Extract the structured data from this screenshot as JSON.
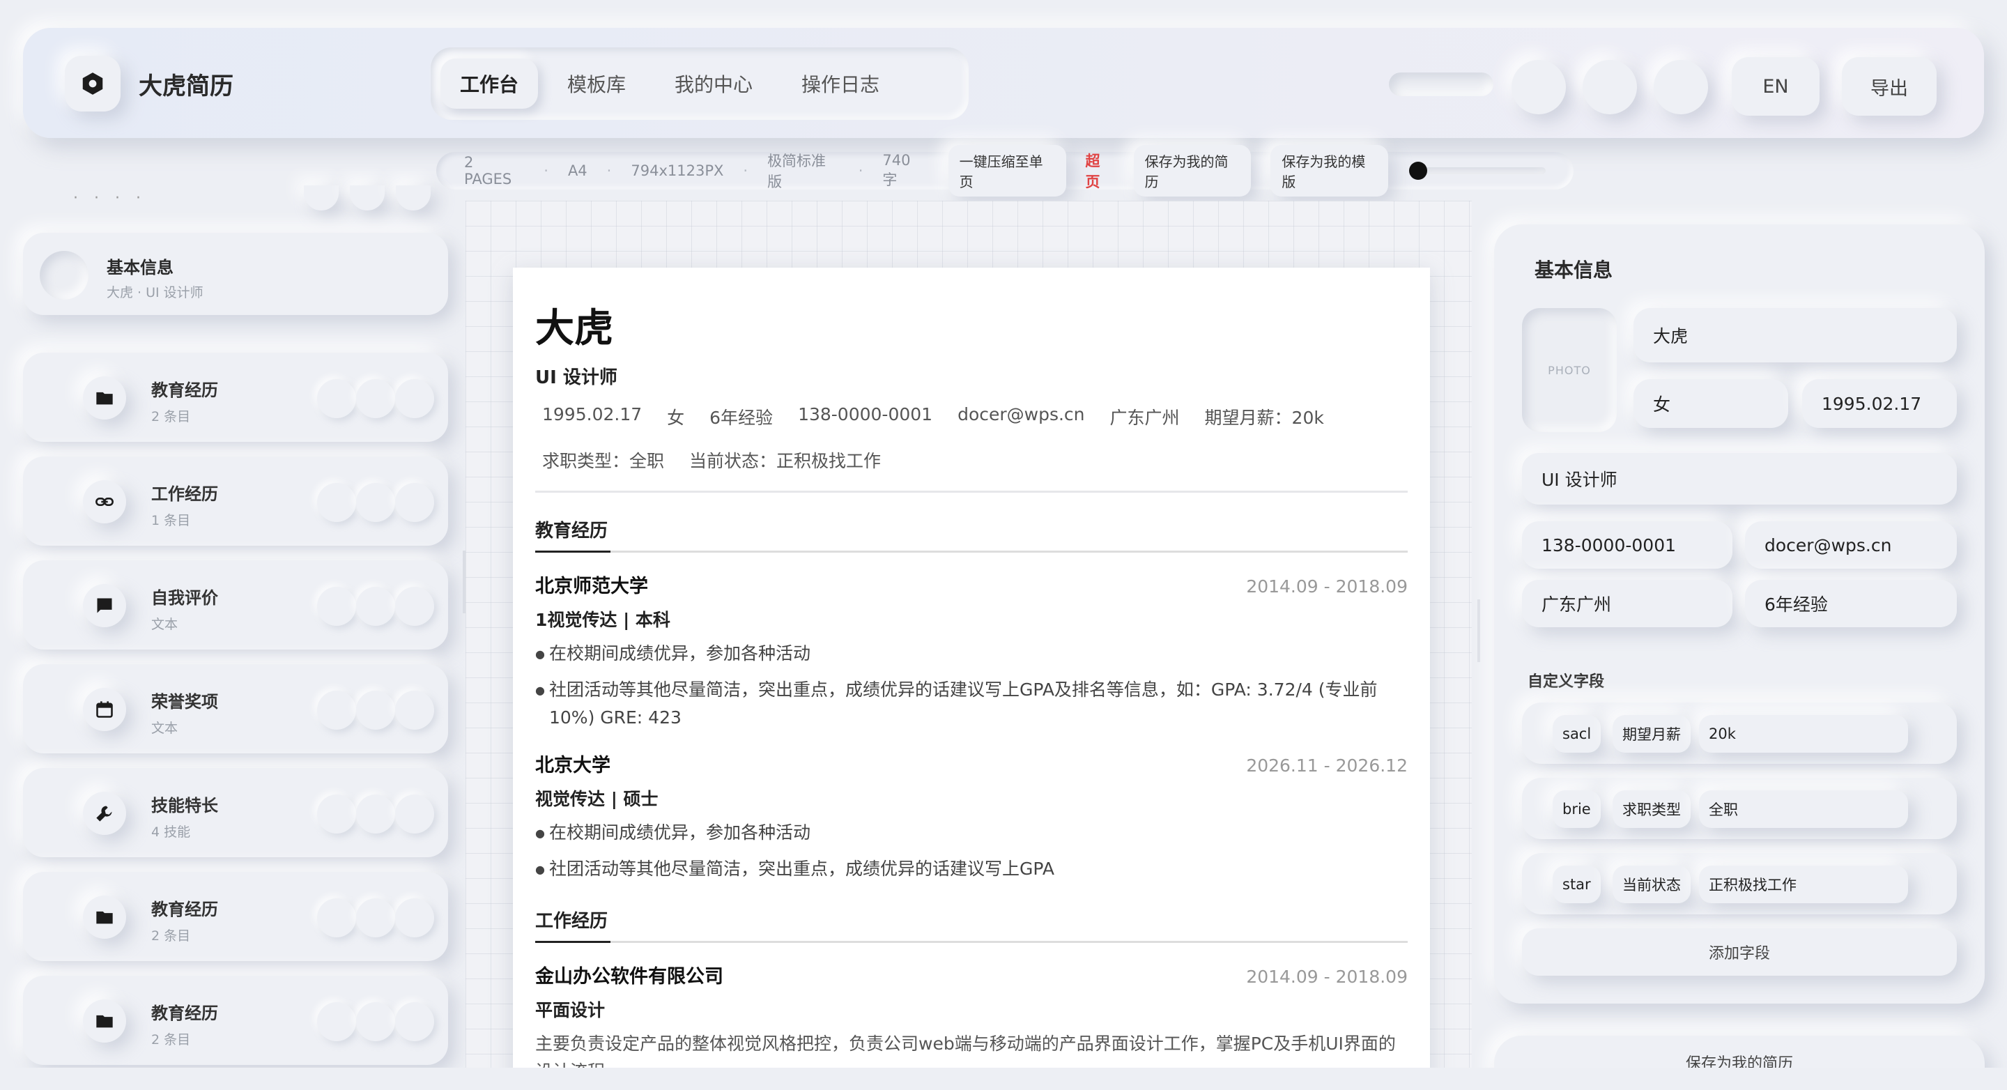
{
  "app": {
    "title": "大虎简历"
  },
  "nav": {
    "tabs": [
      "工作台",
      "模板库",
      "我的中心",
      "操作日志"
    ],
    "active": 0
  },
  "header": {
    "lang_button": "EN",
    "export_button": "导出"
  },
  "info_bar": {
    "pages": "2 PAGES",
    "paper": "A4",
    "size": "794x1123PX",
    "template": "极简标准版",
    "word_count": "740 字",
    "compress_button": "一键压缩至单页",
    "overflow_warning": "超页",
    "save_resume_button": "保存为我的简历",
    "save_template_button": "保存为我的模版"
  },
  "sidebar": {
    "dots": "· · · ·",
    "basic": {
      "title": "基本信息",
      "subtitle": "大虎 · UI 设计师"
    },
    "sections": [
      {
        "title": "教育经历",
        "subtitle": "2 条目",
        "icon": "folder-icon"
      },
      {
        "title": "工作经历",
        "subtitle": "1 条目",
        "icon": "link-icon"
      },
      {
        "title": "自我评价",
        "subtitle": "文本",
        "icon": "comment-icon"
      },
      {
        "title": "荣誉奖项",
        "subtitle": "文本",
        "icon": "calendar-icon"
      },
      {
        "title": "技能特长",
        "subtitle": "4 技能",
        "icon": "wrench-icon"
      },
      {
        "title": "教育经历",
        "subtitle": "2 条目",
        "icon": "folder-icon"
      },
      {
        "title": "教育经历",
        "subtitle": "2 条目",
        "icon": "folder-icon"
      }
    ]
  },
  "resume": {
    "name": "大虎",
    "role": "UI 设计师",
    "meta_line1": [
      "1995.02.17",
      "女",
      "6年经验",
      "138-0000-0001",
      "docer@wps.cn",
      "广东广州",
      "期望月薪：20k"
    ],
    "meta_line2": [
      "求职类型：全职",
      "当前状态：正积极找工作"
    ],
    "education_title": "教育经历",
    "education": [
      {
        "org": "北京师范大学",
        "date": "2014.09 - 2018.09",
        "degree": "1视觉传达 | 本科",
        "bullets": [
          "在校期间成绩优异，参加各种活动",
          "社团活动等其他尽量简洁，突出重点，成绩优异的话建议写上GPA及排名等信息，如：GPA: 3.72/4 (专业前10%) GRE: 423"
        ]
      },
      {
        "org": "北京大学",
        "date": "2026.11 - 2026.12",
        "degree": "视觉传达 | 硕士",
        "bullets": [
          "在校期间成绩优异，参加各种活动",
          "社团活动等其他尽量简洁，突出重点，成绩优异的话建议写上GPA"
        ]
      }
    ],
    "work_title": "工作经历",
    "work": [
      {
        "org": "金山办公软件有限公司",
        "date": "2014.09 - 2018.09",
        "position": "平面设计",
        "description": "主要负责设定产品的整体视觉风格把控，负责公司web端与移动端的产品界面设计工作，掌握PC及手机UI界面的设计流程。"
      }
    ]
  },
  "right_panel": {
    "title": "基本信息",
    "photo_label": "PHOTO",
    "fields": {
      "name": "大虎",
      "gender": "女",
      "birthday": "1995.02.17",
      "role": "UI 设计师",
      "phone": "138-0000-0001",
      "email": "docer@wps.cn",
      "city": "广东广州",
      "experience": "6年经验"
    },
    "custom_label": "自定义字段",
    "custom_fields": [
      {
        "icon": "sacl",
        "key": "期望月薪",
        "value": "20k"
      },
      {
        "icon": "brie",
        "key": "求职类型",
        "value": "全职"
      },
      {
        "icon": "star",
        "key": "当前状态",
        "value": "正积极找工作"
      }
    ],
    "add_field_button": "添加字段",
    "save_button": "保存为我的简历"
  },
  "colors": {
    "background": "#edeff4",
    "warning": "#e04343",
    "text": "#222222"
  }
}
